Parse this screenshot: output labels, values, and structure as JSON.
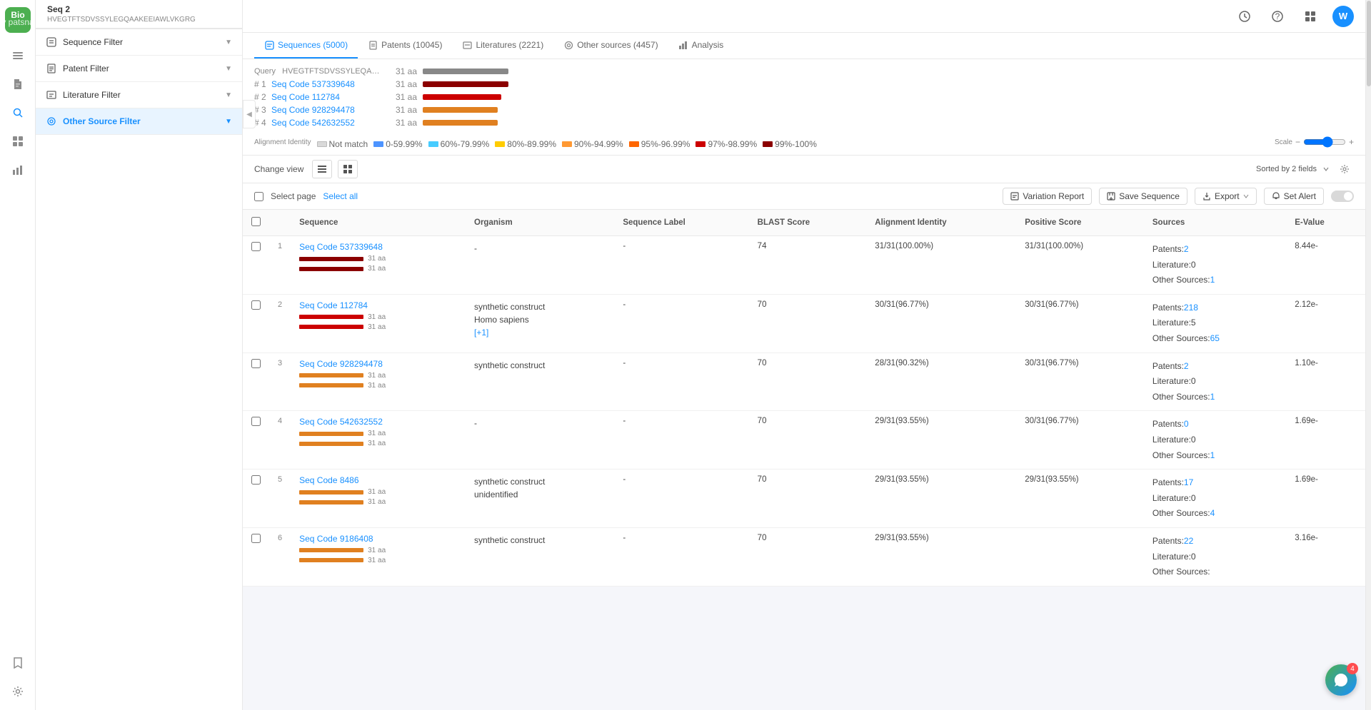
{
  "app": {
    "logo_text": "Bio",
    "logo_subtitle": "by patsnap",
    "user_initial": "W"
  },
  "header": {
    "seq_title": "Seq 2",
    "seq_path": "HVEGTFTSDVSSYLEGQAAKEEIAWLVKGRG"
  },
  "tabs": [
    {
      "id": "sequences",
      "label": "Sequences (5000)",
      "active": true,
      "icon": "dna"
    },
    {
      "id": "patents",
      "label": "Patents (10045)",
      "active": false,
      "icon": "patent"
    },
    {
      "id": "literatures",
      "label": "Literatures (2221)",
      "active": false,
      "icon": "lit"
    },
    {
      "id": "other-sources",
      "label": "Other sources (4457)",
      "active": false,
      "icon": "other"
    },
    {
      "id": "analysis",
      "label": "Analysis",
      "active": false,
      "icon": "chart"
    }
  ],
  "filters": [
    {
      "id": "sequence",
      "label": "Sequence Filter",
      "icon": "dna"
    },
    {
      "id": "patent",
      "label": "Patent Filter",
      "icon": "patent"
    },
    {
      "id": "literature",
      "label": "Literature Filter",
      "icon": "lit"
    },
    {
      "id": "other-source",
      "label": "Other Source Filter",
      "icon": "other",
      "active": true
    }
  ],
  "alignment": {
    "query_label": "Query  HVEGTFTSDVSSYLEQAAKEEIAW...",
    "query_aa": "31 aa",
    "rows": [
      {
        "num": 1,
        "label": "Seq Code 537339648",
        "aa": "31 aa",
        "color": "#8b0000"
      },
      {
        "num": 2,
        "label": "Seq Code 112784",
        "aa": "31 aa",
        "color": "#cc0000"
      },
      {
        "num": 3,
        "label": "Seq Code 928294478",
        "aa": "31 aa",
        "color": "#e08020"
      },
      {
        "num": 4,
        "label": "Seq Code 542632552",
        "aa": "31 aa",
        "color": "#e08020"
      }
    ],
    "legend": [
      {
        "label": "Not match",
        "color": "#d9d9d9"
      },
      {
        "label": "0-59.99%",
        "color": "#4d94ff"
      },
      {
        "label": "60%-79.99%",
        "color": "#47b3ff"
      },
      {
        "label": "80%-89.99%",
        "color": "#ffcc00"
      },
      {
        "label": "90%-94.99%",
        "color": "#ff9933"
      },
      {
        "label": "95%-96.99%",
        "color": "#ff6600"
      },
      {
        "label": "97%-98.99%",
        "color": "#cc0000"
      },
      {
        "label": "99%-100%",
        "color": "#8b0000"
      }
    ],
    "alignment_identity": "Alignment Identity"
  },
  "toolbar": {
    "change_view": "Change view",
    "sorted_by": "Sorted by 2 fields",
    "set_alert": "Set Alert"
  },
  "actions": {
    "select_page": "Select page",
    "select_all": "Select all",
    "variation_report": "Variation Report",
    "save_sequence": "Save Sequence",
    "export": "Export",
    "set_alert": "Set Alert"
  },
  "table": {
    "columns": [
      {
        "id": "num",
        "label": ""
      },
      {
        "id": "sequence",
        "label": "Sequence"
      },
      {
        "id": "organism",
        "label": "Organism"
      },
      {
        "id": "sequence_label",
        "label": "Sequence Label"
      },
      {
        "id": "blast_score",
        "label": "BLAST Score"
      },
      {
        "id": "alignment_identity",
        "label": "Alignment Identity"
      },
      {
        "id": "positive_score",
        "label": "Positive Score"
      },
      {
        "id": "sources",
        "label": "Sources"
      },
      {
        "id": "e_value",
        "label": "E-Value"
      }
    ],
    "rows": [
      {
        "num": 1,
        "sequence": "Seq Code 537339648",
        "organism": "-",
        "sequence_label": "-",
        "blast_score": "74",
        "alignment_identity": "31/31(100.00%)",
        "positive_score": "31/31(100.00%)",
        "sources": {
          "patents": "2",
          "literature": "0",
          "other": "1"
        },
        "e_value": "8.44e-",
        "bar_color": "#8b0000"
      },
      {
        "num": 2,
        "sequence": "Seq Code 112784",
        "organism": "synthetic construct\nHomo sapiens",
        "organism_more": "[+1]",
        "sequence_label": "-",
        "blast_score": "70",
        "alignment_identity": "30/31(96.77%)",
        "positive_score": "30/31(96.77%)",
        "sources": {
          "patents": "218",
          "literature": "5",
          "other": "65"
        },
        "e_value": "2.12e-",
        "bar_color": "#cc0000"
      },
      {
        "num": 3,
        "sequence": "Seq Code 928294478",
        "organism": "synthetic construct",
        "sequence_label": "-",
        "blast_score": "70",
        "alignment_identity": "28/31(90.32%)",
        "positive_score": "30/31(96.77%)",
        "sources": {
          "patents": "2",
          "literature": "0",
          "other": "1"
        },
        "e_value": "1.10e-",
        "bar_color": "#e08020"
      },
      {
        "num": 4,
        "sequence": "Seq Code 542632552",
        "organism": "-",
        "sequence_label": "-",
        "blast_score": "70",
        "alignment_identity": "29/31(93.55%)",
        "positive_score": "30/31(96.77%)",
        "sources": {
          "patents": "0",
          "literature": "0",
          "other": "1"
        },
        "e_value": "1.69e-",
        "bar_color": "#e08020"
      },
      {
        "num": 5,
        "sequence": "Seq Code 8486",
        "organism": "synthetic construct\nunidentified",
        "sequence_label": "-",
        "blast_score": "70",
        "alignment_identity": "29/31(93.55%)",
        "positive_score": "29/31(93.55%)",
        "sources": {
          "patents": "17",
          "literature": "0",
          "other": "4"
        },
        "e_value": "1.69e-",
        "bar_color": "#e08020"
      },
      {
        "num": 6,
        "sequence": "Seq Code 9186408",
        "organism": "synthetic construct",
        "sequence_label": "-",
        "blast_score": "70",
        "alignment_identity": "29/31(93.55%)",
        "positive_score": "",
        "sources": {
          "patents": "22",
          "literature": "0",
          "other": ""
        },
        "e_value": "3.16e-",
        "bar_color": "#e08020"
      }
    ]
  }
}
